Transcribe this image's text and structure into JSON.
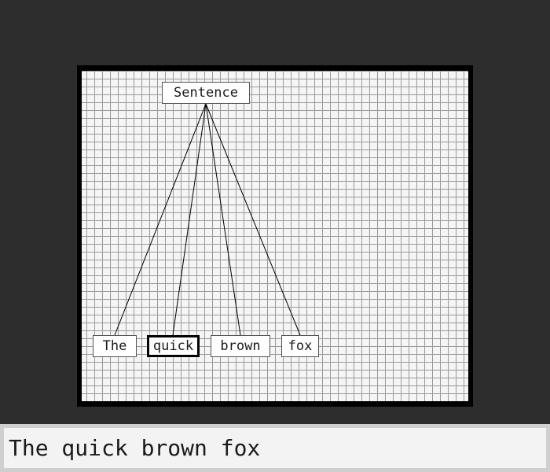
{
  "tree": {
    "root": {
      "label": "Sentence"
    },
    "leaves": [
      {
        "label": "The",
        "selected": false
      },
      {
        "label": "quick",
        "selected": true
      },
      {
        "label": "brown",
        "selected": false
      },
      {
        "label": "fox",
        "selected": false
      }
    ]
  },
  "input": {
    "value": "The quick brown fox"
  },
  "colors": {
    "background": "#2d2d2d",
    "frame": "#000000",
    "grid_paper": "#f5f5f5",
    "grid_line": "#9a9a9a",
    "node_fill": "#ffffff",
    "input_fill": "#f3f3f3"
  }
}
